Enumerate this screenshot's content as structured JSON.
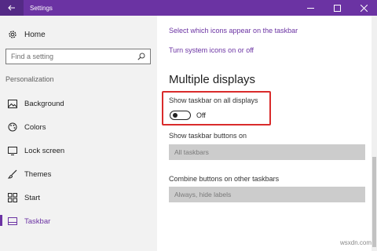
{
  "window": {
    "title": "Settings"
  },
  "sidebar": {
    "home_label": "Home",
    "search_placeholder": "Find a setting",
    "section_label": "Personalization",
    "items": [
      {
        "label": "Background",
        "icon": "picture-icon"
      },
      {
        "label": "Colors",
        "icon": "palette-icon"
      },
      {
        "label": "Lock screen",
        "icon": "monitor-icon"
      },
      {
        "label": "Themes",
        "icon": "brush-icon"
      },
      {
        "label": "Start",
        "icon": "start-icon"
      },
      {
        "label": "Taskbar",
        "icon": "taskbar-icon",
        "active": true
      }
    ]
  },
  "main": {
    "link1": "Select which icons appear on the taskbar",
    "link2": "Turn system icons on or off",
    "heading": "Multiple displays",
    "show_taskbar_label": "Show taskbar on all displays",
    "toggle_state": "Off",
    "buttons_label": "Show taskbar buttons on",
    "buttons_value": "All taskbars",
    "combine_label": "Combine buttons on other taskbars",
    "combine_value": "Always, hide labels"
  },
  "colors": {
    "accent": "#6b33a3",
    "highlight_border": "#d92b2b"
  },
  "watermark": "wsxdn.com"
}
